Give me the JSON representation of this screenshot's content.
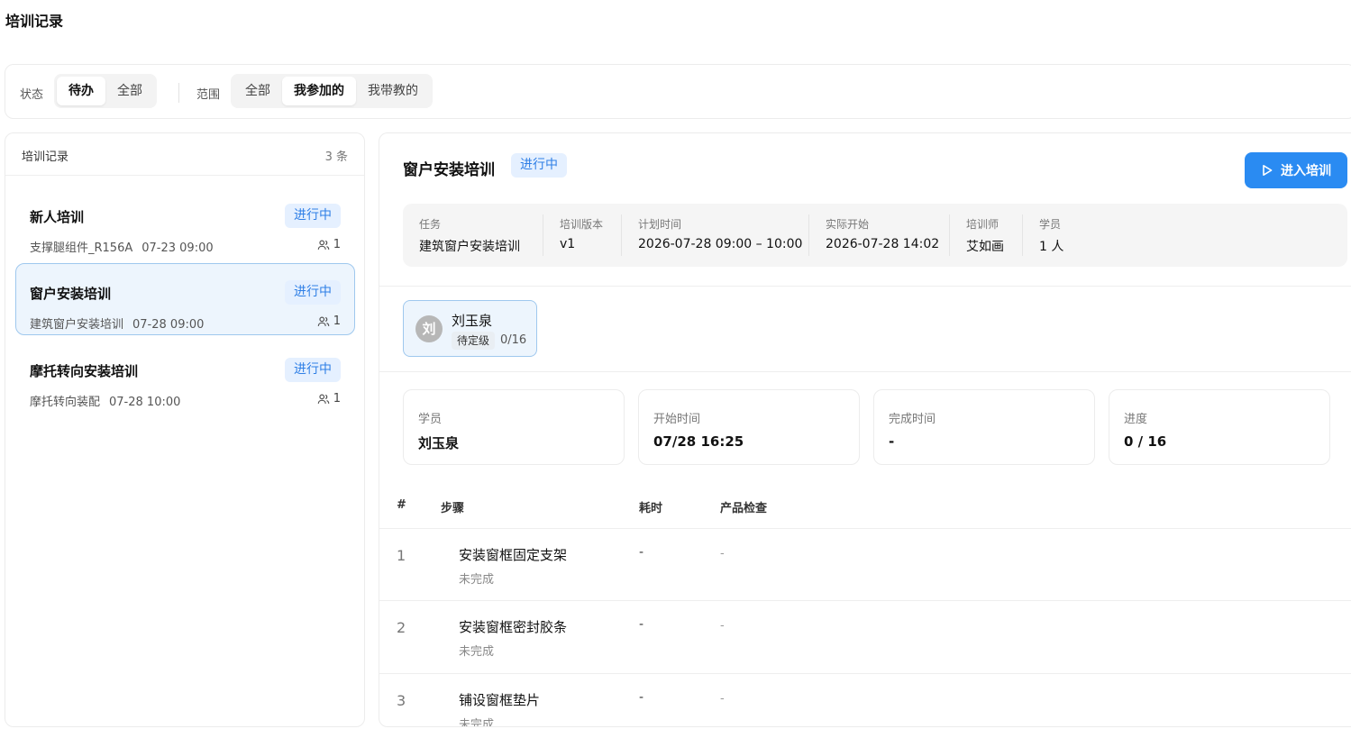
{
  "page": {
    "title": "培训记录"
  },
  "filters": {
    "status_label": "状态",
    "status_options": [
      "待办",
      "全部"
    ],
    "scope_label": "范围",
    "scope_options": [
      "全部",
      "我参加的",
      "我带教的"
    ]
  },
  "list": {
    "title": "培训记录",
    "count": "3 条",
    "items": [
      {
        "title": "新人培训",
        "badge": "进行中",
        "task": "支撑腿组件_R156A",
        "time": "07-23 09:00",
        "people": "1"
      },
      {
        "title": "窗户安装培训",
        "badge": "进行中",
        "task": "建筑窗户安装培训",
        "time": "07-28 09:00",
        "people": "1"
      },
      {
        "title": "摩托转向安装培训",
        "badge": "进行中",
        "task": "摩托转向装配",
        "time": "07-28 10:00",
        "people": "1"
      }
    ]
  },
  "detail": {
    "title": "窗户安装培训",
    "badge": "进行中",
    "enter_label": "进入培训",
    "info": [
      {
        "key": "任务",
        "value": "建筑窗户安装培训"
      },
      {
        "key": "培训版本",
        "value": "v1"
      },
      {
        "key": "计划时间",
        "value": "2026-07-28 09:00 – 10:00"
      },
      {
        "key": "实际开始",
        "value": "2026-07-28 14:02"
      },
      {
        "key": "培训师",
        "value": "艾如画"
      },
      {
        "key": "学员",
        "value": "1 人"
      }
    ],
    "trainee": {
      "avatar": "刘",
      "name": "刘玉泉",
      "tag": "待定级",
      "progress": "0/16"
    },
    "stats": [
      {
        "key": "学员",
        "value": "刘玉泉"
      },
      {
        "key": "开始时间",
        "value": "07/28 16:25"
      },
      {
        "key": "完成时间",
        "value": "-"
      },
      {
        "key": "进度",
        "value": "0 / 16"
      }
    ],
    "table": {
      "headers": [
        "#",
        "步骤",
        "耗时",
        "产品检查"
      ],
      "rows": [
        {
          "num": "1",
          "name": "安装窗框固定支架",
          "status": "未完成",
          "time": "-",
          "check": "-"
        },
        {
          "num": "2",
          "name": "安装窗框密封胶条",
          "status": "未完成",
          "time": "-",
          "check": "-"
        },
        {
          "num": "3",
          "name": "铺设窗框垫片",
          "status": "未完成",
          "time": "-",
          "check": "-"
        }
      ]
    }
  },
  "colors": {
    "accent": "#2a8bf2",
    "badge_bg": "#e5f0ff",
    "badge_text": "#2f7fe6",
    "selected_bg": "#edf5fd"
  }
}
